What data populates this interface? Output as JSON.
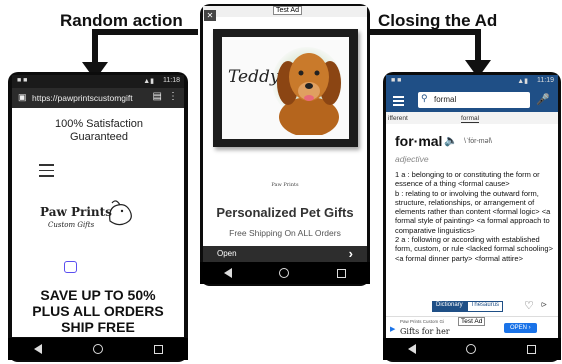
{
  "labels": {
    "random_action": "Random action",
    "closing_ad": "Closing the Ad"
  },
  "left_phone": {
    "status_time": "11:18",
    "url": "https://pawprintscustomgift",
    "satisfaction": "100% Satisfaction Guaranteed",
    "logo_title": "Paw Prints",
    "logo_sub": "Custom Gifts",
    "sale_lines": [
      "SAVE UP TO 50%",
      "PLUS ALL ORDERS",
      "SHIP FREE"
    ]
  },
  "middle_phone": {
    "test_ad": "Test Ad",
    "close": "✕",
    "portrait_name": "Teddy",
    "brand_small": "Paw Prints",
    "title": "Personalized Pet Gifts",
    "subtitle": "Free Shipping On ALL Orders",
    "open_label": "Open",
    "open_arrow": "›"
  },
  "right_phone": {
    "status_time": "11:19",
    "search_value": "formal",
    "tab_left": "ifferent",
    "tab_active": "formal",
    "headword": "for·mal",
    "pronunciation": "\\ˈfȯr-məl\\",
    "pos": "adjective",
    "definitions": [
      "1 a : belonging to or constituting the form or essence of a thing <formal cause>",
      "b : relating to or involving the outward form, structure, relationships, or arrangement of elements rather than content <formal logic> <a formal style of painting> <a formal approach to comparative linguistics>",
      "2 a : following or according with established form, custom, or rule <lacked formal schooling> <a formal dinner party> <formal attire>"
    ],
    "tabs": [
      "Dictionary",
      "Thesaurus"
    ],
    "ad_label": "Test Ad",
    "ad_brand": "Paw Prints Custom Gi",
    "ad_text": "Gifts for her",
    "ad_button": "OPEN ›"
  },
  "colors": {
    "accent_blue": "#1f4f86",
    "dict_red": "#c0392b",
    "open_btn": "#1a73e8"
  }
}
